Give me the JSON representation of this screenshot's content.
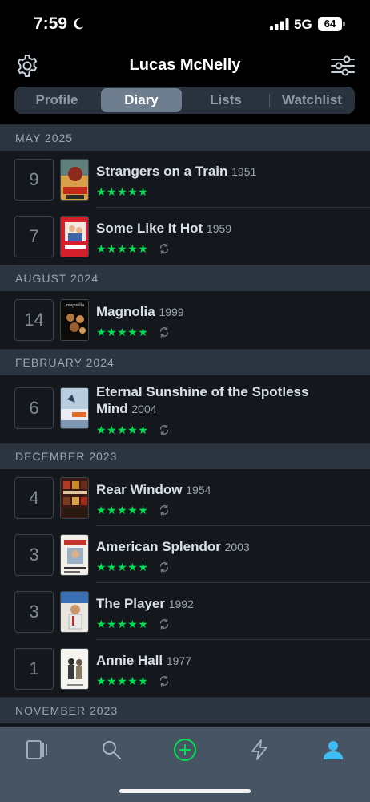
{
  "status_bar": {
    "time": "7:59",
    "network": "5G",
    "battery": "64",
    "icons": [
      "moon-icon",
      "signal-icon",
      "battery-icon"
    ]
  },
  "header": {
    "title": "Lucas McNelly",
    "left_icon": "gear-icon",
    "right_icon": "filter-icon"
  },
  "tabs": [
    "Profile",
    "Diary",
    "Lists",
    "Watchlist"
  ],
  "active_tab": "Diary",
  "accent_colors": {
    "stars": "#00e054",
    "add_button": "#00e054",
    "profile_active": "#40bcf4",
    "background": "#14181c",
    "section_header": "#2c3440"
  },
  "sections": [
    {
      "label": "MAY 2025",
      "entries": [
        {
          "day": "9",
          "title": "Strangers on a Train",
          "year": "1951",
          "stars": "★★★★★",
          "rewatch": false
        },
        {
          "day": "7",
          "title": "Some Like It Hot",
          "year": "1959",
          "stars": "★★★★★",
          "rewatch": true
        }
      ]
    },
    {
      "label": "AUGUST 2024",
      "entries": [
        {
          "day": "14",
          "title": "Magnolia",
          "year": "1999",
          "stars": "★★★★★",
          "rewatch": true,
          "poster_text": "magnolia"
        }
      ]
    },
    {
      "label": "FEBRUARY 2024",
      "entries": [
        {
          "day": "6",
          "title_line1": "Eternal Sunshine of the Spotless",
          "title_line2": "Mind",
          "year": "2004",
          "stars": "★★★★★",
          "rewatch": true
        }
      ]
    },
    {
      "label": "DECEMBER 2023",
      "entries": [
        {
          "day": "4",
          "title": "Rear Window",
          "year": "1954",
          "stars": "★★★★★",
          "rewatch": true
        },
        {
          "day": "3",
          "title": "American Splendor",
          "year": "2003",
          "stars": "★★★★★",
          "rewatch": true
        },
        {
          "day": "3",
          "title": "The Player",
          "year": "1992",
          "stars": "★★★★★",
          "rewatch": true
        },
        {
          "day": "1",
          "title": "Annie Hall",
          "year": "1977",
          "stars": "★★★★★",
          "rewatch": true
        }
      ]
    },
    {
      "label": "NOVEMBER 2023",
      "entries": []
    }
  ],
  "bottom_nav": [
    {
      "icon": "films-icon"
    },
    {
      "icon": "search-icon"
    },
    {
      "icon": "add-icon"
    },
    {
      "icon": "activity-icon"
    },
    {
      "icon": "profile-icon"
    }
  ]
}
